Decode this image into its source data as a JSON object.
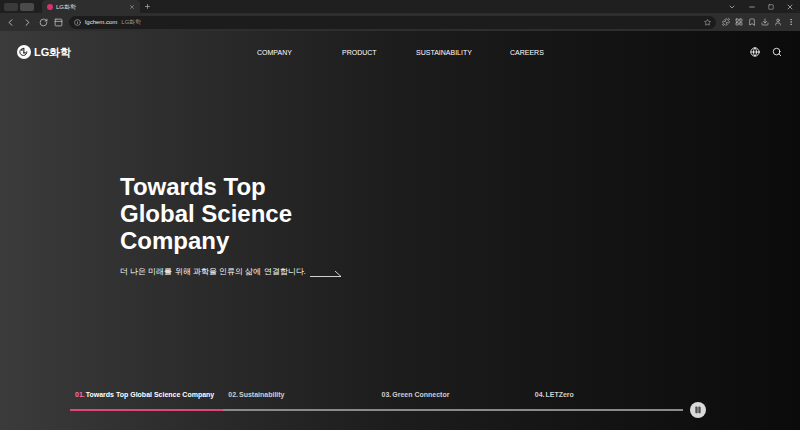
{
  "browser": {
    "tab": {
      "title": "LG화학",
      "selected": true
    },
    "address": {
      "url": "lgchem.com",
      "title": "LG화학"
    }
  },
  "header": {
    "logo": "LG화학",
    "nav": [
      {
        "label": "COMPANY"
      },
      {
        "label": "PRODUCT"
      },
      {
        "label": "SUSTAINABILITY"
      },
      {
        "label": "CAREERS"
      }
    ]
  },
  "hero": {
    "headline": [
      "Towards Top",
      "Global Science",
      "Company"
    ],
    "subtitle": "더 나은 미래를 위해 과학을 인류의 삶에 연결합니다."
  },
  "slides": [
    {
      "number": "01.",
      "label": "Towards Top Global Science Company",
      "selected": true,
      "level": 1
    },
    {
      "number": "02.",
      "label": "Sustainability",
      "selected": false,
      "level": 0
    },
    {
      "number": "03.",
      "label": "Green Connector",
      "selected": false,
      "level": 0
    },
    {
      "number": "04.",
      "label": "LETZero",
      "selected": false,
      "level": 0
    }
  ],
  "player": {
    "playing": true
  }
}
